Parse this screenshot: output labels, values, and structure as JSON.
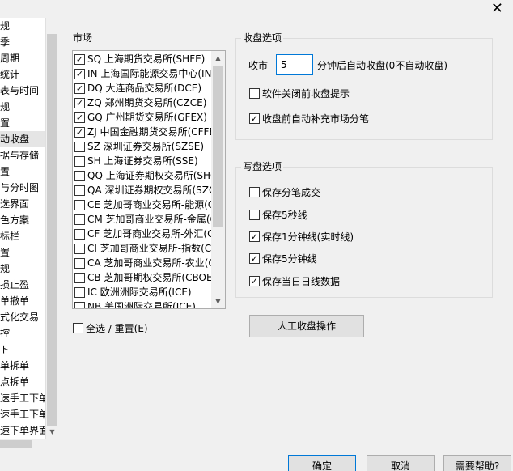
{
  "nav": {
    "items": [
      {
        "label": "规"
      },
      {
        "label": "季"
      },
      {
        "label": "周期"
      },
      {
        "label": "统计"
      },
      {
        "label": "表与时间"
      },
      {
        "label": "规"
      },
      {
        "label": "置"
      },
      {
        "label": "动收盘",
        "selected": true
      },
      {
        "label": "据与存储"
      },
      {
        "label": "置"
      },
      {
        "label": "与分时图"
      },
      {
        "label": "选界面"
      },
      {
        "label": "色方案"
      },
      {
        "label": "标栏"
      },
      {
        "label": "置"
      },
      {
        "label": "规"
      },
      {
        "label": "损止盈"
      },
      {
        "label": "单撤单"
      },
      {
        "label": "式化交易"
      },
      {
        "label": "控"
      },
      {
        "label": "ト"
      },
      {
        "label": "单拆单"
      },
      {
        "label": "点拆单"
      },
      {
        "label": "速手工下单"
      },
      {
        "label": "速手工下单"
      },
      {
        "label": "速下单界面"
      }
    ]
  },
  "market": {
    "title": "市场",
    "items": [
      {
        "label": "SQ 上海期货交易所(SHFE)",
        "checked": true
      },
      {
        "label": "IN 上海国际能源交易中心(INE)",
        "checked": true
      },
      {
        "label": "DQ 大连商品交易所(DCE)",
        "checked": true
      },
      {
        "label": "ZQ 郑州期货交易所(CZCE)",
        "checked": true
      },
      {
        "label": "GQ 广州期货交易所(GFEX)",
        "checked": true
      },
      {
        "label": "ZJ 中国金融期货交易所(CFFEX)",
        "checked": true
      },
      {
        "label": "SZ 深圳证券交易所(SZSE)",
        "checked": false
      },
      {
        "label": "SH 上海证券交易所(SSE)",
        "checked": false
      },
      {
        "label": "QQ 上海证券期权交易所(SHQQ)",
        "checked": false
      },
      {
        "label": "QA 深圳证券期权交易所(SZQA)",
        "checked": false
      },
      {
        "label": "CE 芝加哥商业交易所-能源(CME)",
        "checked": false
      },
      {
        "label": "CM 芝加哥商业交易所-金属(CME)",
        "checked": false
      },
      {
        "label": "CF 芝加哥商业交易所-外汇(CME)",
        "checked": false
      },
      {
        "label": "CI 芝加哥商业交易所-指数(CME)",
        "checked": false
      },
      {
        "label": "CA 芝加哥商业交易所-农业(CME)",
        "checked": false
      },
      {
        "label": "CB 芝加哥期权交易所(CBOE)",
        "checked": false
      },
      {
        "label": "IC 欧洲洲际交易所(ICE)",
        "checked": false
      },
      {
        "label": "NB 美国洲际交易所(ICE)",
        "checked": false
      }
    ],
    "select_all_label": "全选 / 重置(E)",
    "select_all_checked": false
  },
  "close_options": {
    "title": "收盘选项",
    "close_market_label": "收市",
    "minutes_value": "5",
    "after_minutes_label": "分钟后自动收盘(0不自动收盘)",
    "prompt_before_exit": {
      "label": "软件关闭前收盘提示",
      "checked": false
    },
    "auto_fill_ticks": {
      "label": "收盘前自动补充市场分笔",
      "checked": true
    }
  },
  "write_options": {
    "title": "写盘选项",
    "items": [
      {
        "label": "保存分笔成交",
        "checked": false
      },
      {
        "label": "保存5秒线",
        "checked": false
      },
      {
        "label": "保存1分钟线(实时线)",
        "checked": true
      },
      {
        "label": "保存5分钟线",
        "checked": true
      },
      {
        "label": "保存当日日线数据",
        "checked": true
      }
    ]
  },
  "manual_close_button": "人工收盘操作",
  "footer": {
    "ok_label": "确定",
    "cancel_label": "取消",
    "help_label": "需要帮助?"
  }
}
